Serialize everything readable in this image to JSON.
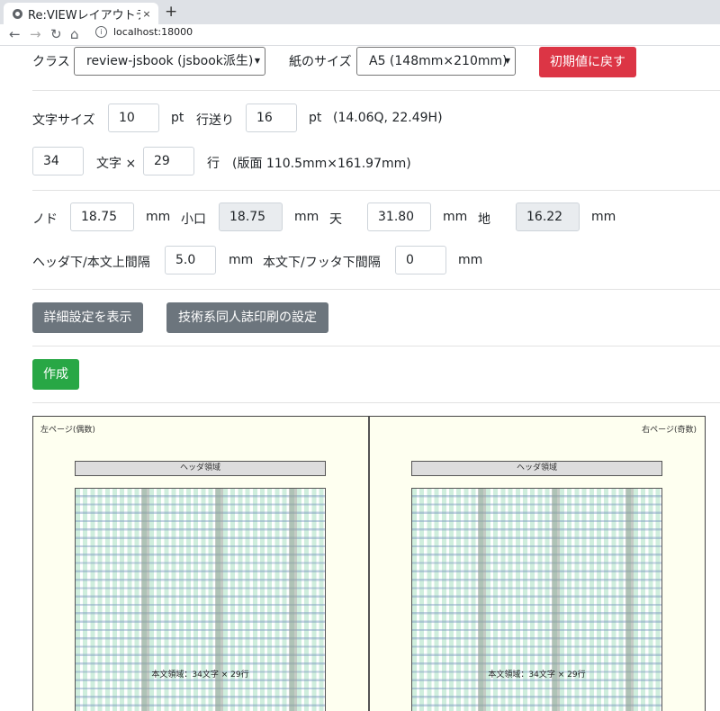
{
  "browser": {
    "tab_title": "Re:VIEWレイアウトテ",
    "close_glyph": "×",
    "new_tab_glyph": "+",
    "url_scheme_icon": "info-icon",
    "url": "localhost:18000"
  },
  "form": {
    "class_label": "クラス",
    "class_value": "review-jsbook (jsbook派生)",
    "paper_label": "紙のサイズ",
    "paper_value": "A5 (148mm×210mm)",
    "reset_button": "初期値に戻す",
    "font_size_label": "文字サイズ",
    "font_size_value": "10",
    "pt1": "pt",
    "line_feed_label": "行送り",
    "line_feed_value": "16",
    "pt2": "pt",
    "q_info": "(14.06Q, 22.49H)",
    "chars_value": "34",
    "chars_label": "文字 ×",
    "lines_value": "29",
    "lines_label": "行",
    "hanmen_info": "(版面 110.5mm×161.97mm)",
    "nodo_label": "ノド",
    "nodo_value": "18.75",
    "mm1": "mm",
    "koguchi_label": "小口",
    "koguchi_value": "18.75",
    "mm2": "mm",
    "ten_label": "天",
    "ten_value": "31.80",
    "mm3": "mm",
    "chi_label": "地",
    "chi_value": "16.22",
    "mm4": "mm",
    "header_gap_label": "ヘッダ下/本文上間隔",
    "header_gap_value": "5.0",
    "mm5": "mm",
    "footer_gap_label": "本文下/フッタ下間隔",
    "footer_gap_value": "0",
    "mm6": "mm",
    "detail_button": "詳細設定を表示",
    "doujin_button": "技術系同人誌印刷の設定",
    "create_button": "作成"
  },
  "preview": {
    "left_page_label": "左ページ(偶数)",
    "right_page_label": "右ページ(奇数)",
    "header_area_left": "ヘッダ領域",
    "header_area_right": "ヘッダ領域",
    "body_area_left": "本文領域：34文字 × 29行",
    "body_area_right": "本文領域：34文字 × 29行"
  },
  "colors": {
    "reset_button": "#dc3545",
    "secondary_button": "#6c757d",
    "create_button": "#28a745"
  }
}
